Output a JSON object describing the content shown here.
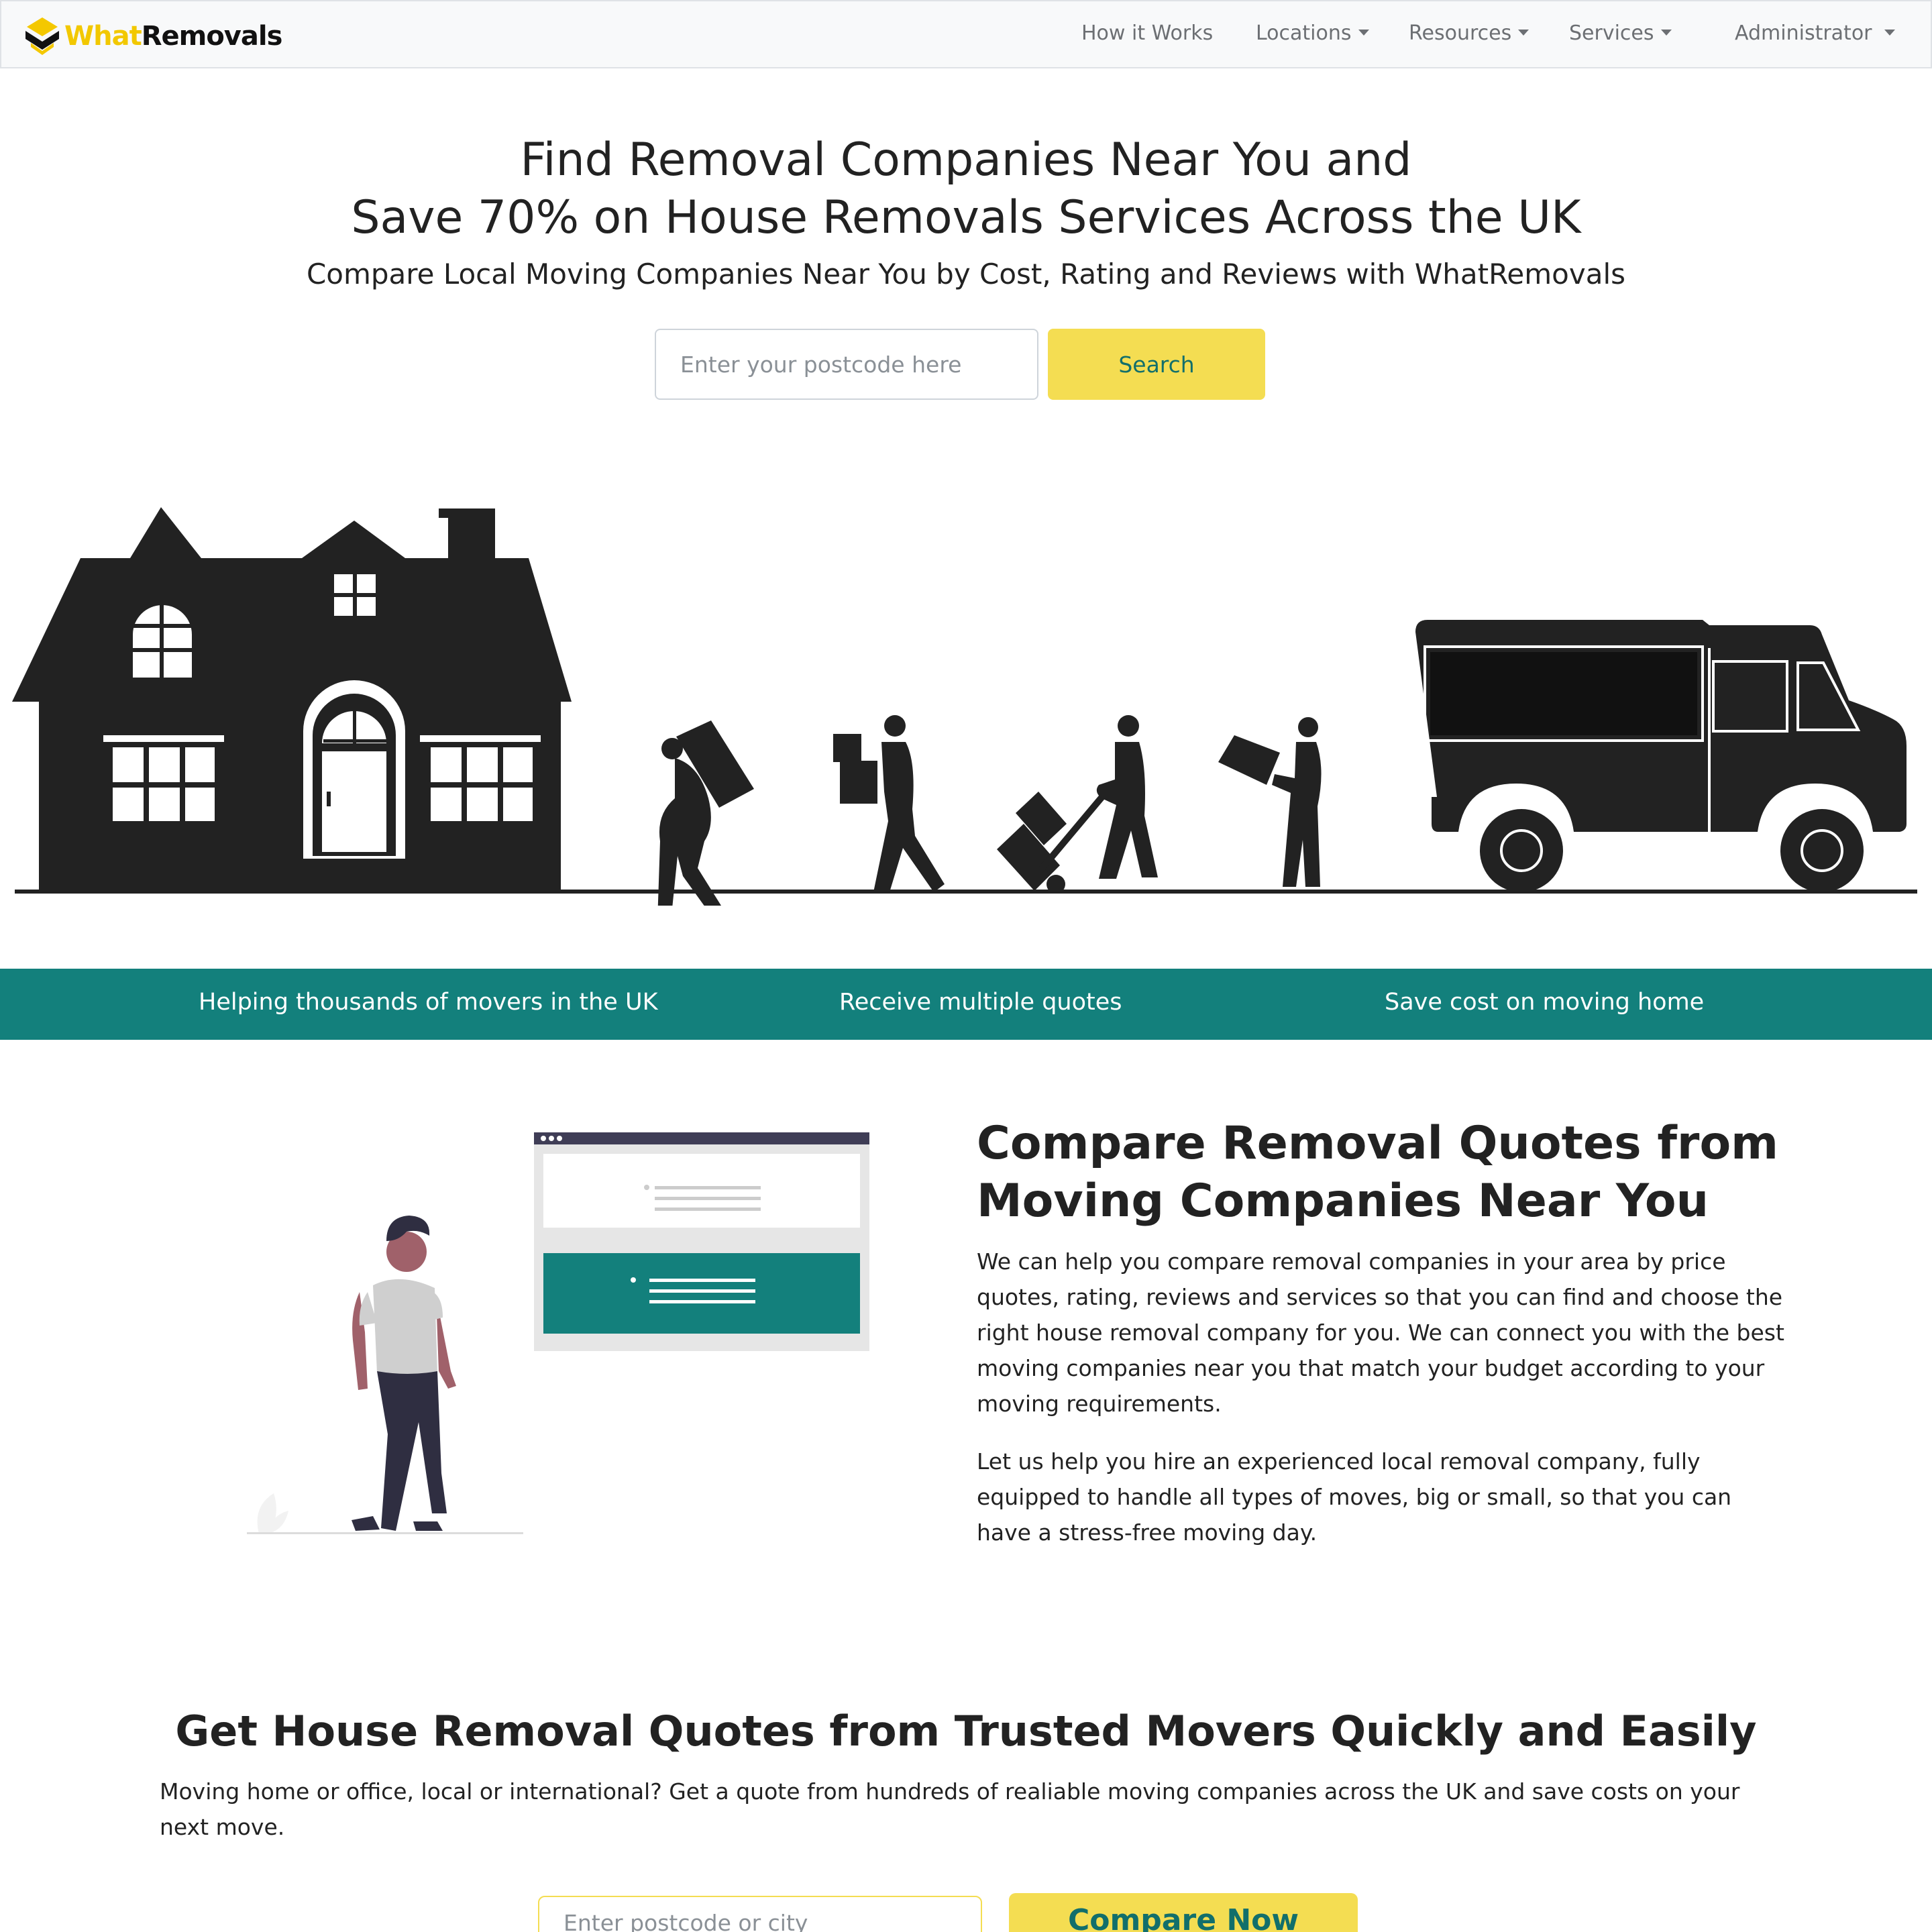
{
  "brand": {
    "name_part1": "What",
    "name_part2": "Removals"
  },
  "nav": {
    "how_it_works": "How it Works",
    "locations": "Locations",
    "resources": "Resources",
    "services": "Services",
    "account": "Administrator"
  },
  "hero": {
    "title_line1": "Find Removal Companies Near You and",
    "title_line2": "Save 70% on House Removals Services Across the UK",
    "subtitle": "Compare Local Moving Companies Near You by Cost, Rating and Reviews with WhatRemovals",
    "postcode_placeholder": "Enter your postcode here",
    "search_label": "Search"
  },
  "features": [
    "Helping thousands of movers in the UK",
    "Receive multiple quotes",
    "Save cost on moving home"
  ],
  "compare": {
    "title_line1": "Compare Removal Quotes from",
    "title_line2": "Moving Companies Near You",
    "para1": "We can help you compare removal companies in your area by price quotes, rating, reviews and services so that you can find and choose the right house removal company for you. We can connect you with the best moving companies near you that match your budget according to your moving requirements.",
    "para2": "Let us help you hire an experienced local removal company, fully equipped to handle all types of moves, big or small, so that you can have a stress-free moving day."
  },
  "quotes": {
    "title": "Get House Removal Quotes from Trusted Movers Quickly and Easily",
    "para": "Moving home or office, local or international? Get a quote from hundreds of realiable moving companies across the UK and save costs on your next move.",
    "input_placeholder": "Enter postcode or city",
    "button_label": "Compare Now"
  },
  "colors": {
    "brand_yellow": "#f4dd52",
    "teal": "#13807c",
    "dark": "#222222"
  }
}
